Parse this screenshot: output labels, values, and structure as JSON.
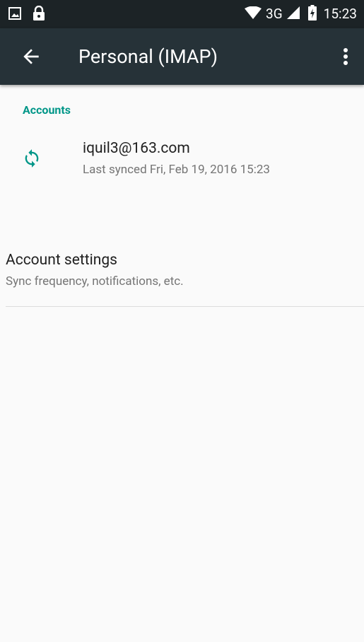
{
  "status_bar": {
    "network": "3G",
    "time": "15:23",
    "icons": [
      "image-notification-icon",
      "lock-icon",
      "wifi-icon",
      "signal-icon",
      "battery-charging-icon"
    ]
  },
  "app_bar": {
    "title": "Personal (IMAP)",
    "back_icon": "arrow-back-icon",
    "menu_icon": "more-vert-icon"
  },
  "accounts_section": {
    "header": "Accounts",
    "items": [
      {
        "email": "iquil3@163.com",
        "last_synced": "Last synced Fri, Feb 19, 2016 15:23",
        "icon": "sync-icon"
      }
    ]
  },
  "settings": {
    "title": "Account settings",
    "subtitle": "Sync frequency, notifications, etc."
  },
  "colors": {
    "status_bar_bg": "#1c2326",
    "app_bar_bg": "#263238",
    "accent": "#009688",
    "background": "#fafafa"
  }
}
